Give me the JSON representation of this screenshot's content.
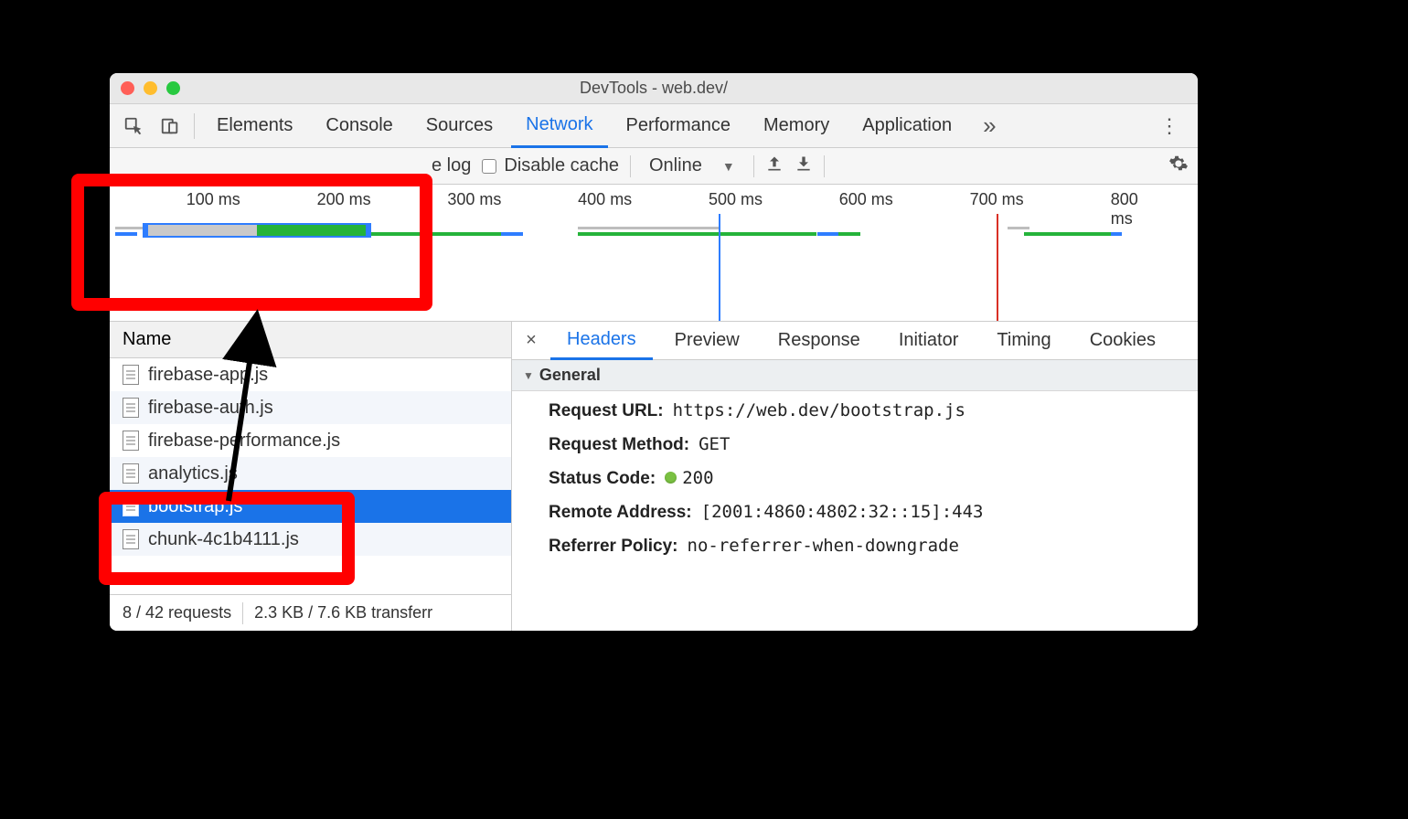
{
  "window": {
    "title": "DevTools - web.dev/"
  },
  "tabs": {
    "items": [
      "Elements",
      "Console",
      "Sources",
      "Network",
      "Performance",
      "Memory",
      "Application"
    ],
    "active_index": 3
  },
  "toolbar": {
    "preserve_log_label": "e log",
    "disable_cache_label": "Disable cache",
    "throttle_label": "Online"
  },
  "overview": {
    "ticks": [
      "100 ms",
      "200 ms",
      "300 ms",
      "400 ms",
      "500 ms",
      "600 ms",
      "700 ms",
      "800 ms"
    ]
  },
  "request_list": {
    "header": "Name",
    "rows": [
      {
        "name": "firebase-app.js",
        "selected": false
      },
      {
        "name": "firebase-auth.js",
        "selected": false
      },
      {
        "name": "firebase-performance.js",
        "selected": false
      },
      {
        "name": "analytics.js",
        "selected": false
      },
      {
        "name": "bootstrap.js",
        "selected": true
      },
      {
        "name": "chunk-4c1b4111.js",
        "selected": false
      }
    ],
    "status": {
      "requests": "8 / 42 requests",
      "transfer": "2.3 KB / 7.6 KB transferr"
    }
  },
  "detail": {
    "tabs": [
      "Headers",
      "Preview",
      "Response",
      "Initiator",
      "Timing",
      "Cookies"
    ],
    "active_index": 0,
    "section_title": "General",
    "general": {
      "request_url_k": "Request URL:",
      "request_url_v": "https://web.dev/bootstrap.js",
      "request_method_k": "Request Method:",
      "request_method_v": "GET",
      "status_code_k": "Status Code:",
      "status_code_v": "200",
      "remote_address_k": "Remote Address:",
      "remote_address_v": "[2001:4860:4802:32::15]:443",
      "referrer_policy_k": "Referrer Policy:",
      "referrer_policy_v": "no-referrer-when-downgrade"
    }
  }
}
